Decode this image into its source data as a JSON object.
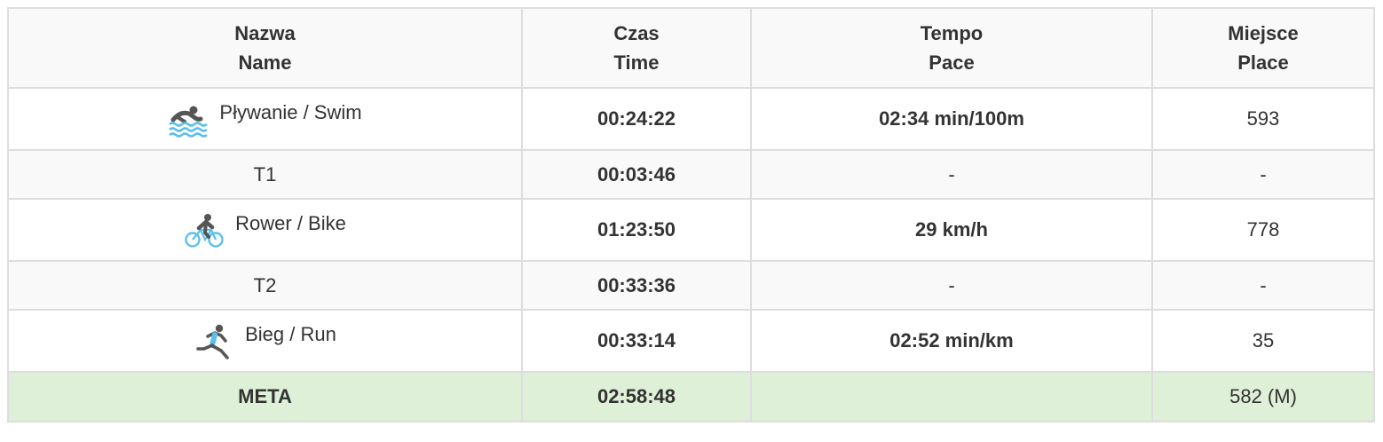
{
  "table": {
    "headers": [
      {
        "pl": "Nazwa",
        "en": "Name"
      },
      {
        "pl": "Czas",
        "en": "Time"
      },
      {
        "pl": "Tempo",
        "en": "Pace"
      },
      {
        "pl": "Miejsce",
        "en": "Place"
      }
    ],
    "rows": [
      {
        "icon": "swim-icon",
        "name": "Pływanie / Swim",
        "time": "00:24:22",
        "pace": "02:34 min/100m",
        "place": "593"
      },
      {
        "icon": "",
        "name": "T1",
        "time": "00:03:46",
        "pace": "-",
        "place": "-"
      },
      {
        "icon": "bike-icon",
        "name": "Rower / Bike",
        "time": "01:23:50",
        "pace": "29 km/h",
        "place": "778"
      },
      {
        "icon": "",
        "name": "T2",
        "time": "00:33:36",
        "pace": "-",
        "place": "-"
      },
      {
        "icon": "run-icon",
        "name": "Bieg / Run",
        "time": "00:33:14",
        "pace": "02:52 min/km",
        "place": "35"
      }
    ],
    "finish": {
      "name": "META",
      "time": "02:58:48",
      "pace": "",
      "place": "582 (M)"
    }
  },
  "colors": {
    "border": "#dddddd",
    "header_bg": "#f9f9f9",
    "stripe_bg": "#f9f9f9",
    "finish_bg": "#dff0d8",
    "icon_blue": "#5bc0eb",
    "icon_dark": "#555555"
  }
}
